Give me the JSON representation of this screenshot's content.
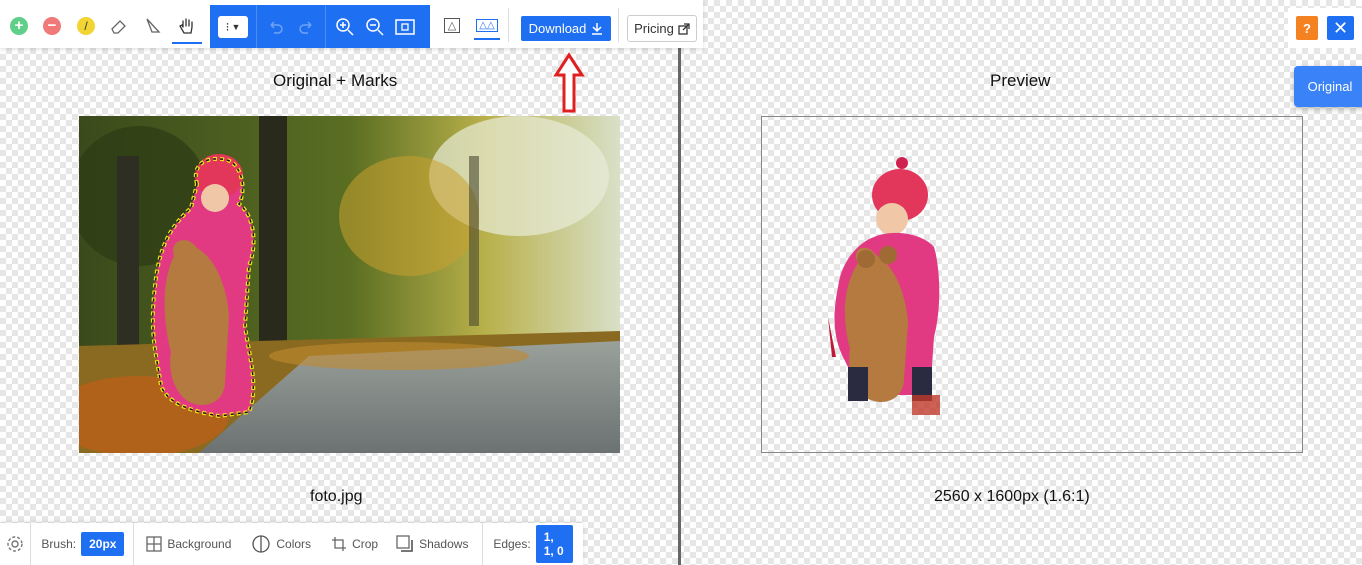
{
  "toolbar": {
    "download_label": "Download",
    "pricing_label": "Pricing",
    "mode_label": "⁝",
    "view_single": "△",
    "view_split": "△△"
  },
  "left_panel": {
    "title": "Original + Marks",
    "filename": "foto.jpg"
  },
  "right_panel": {
    "title": "Preview",
    "dimensions": "2560 x 1600px (1.6:1)"
  },
  "topright": {
    "help_label": "?",
    "close_label": "✕",
    "original_label": "Original"
  },
  "bottom_bar": {
    "brush_label": "Brush:",
    "brush_value": "20px",
    "background_label": "Background",
    "colors_label": "Colors",
    "crop_label": "Crop",
    "shadows_label": "Shadows",
    "edges_label": "Edges:",
    "edges_value": "1, 1, 0"
  },
  "colors": {
    "accent": "#1e6ff2",
    "help": "#f58220",
    "arrow": "#e02020"
  }
}
